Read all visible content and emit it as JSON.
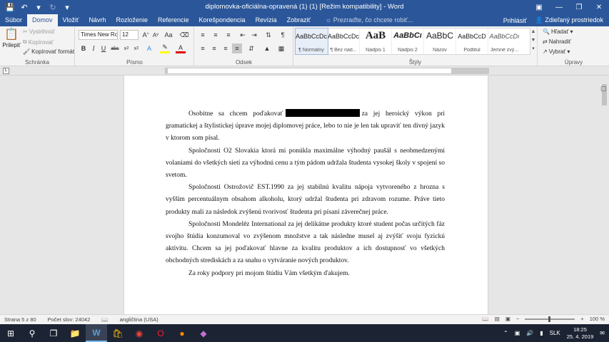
{
  "window": {
    "title": "diplomovka-oficiálna-opravená (1) (1) [Režim kompatibility] - Word"
  },
  "tabs": [
    "Súbor",
    "Domov",
    "Vložiť",
    "Návrh",
    "Rozloženie",
    "Referencie",
    "Korešpondencia",
    "Revízia",
    "Zobraziť"
  ],
  "active_tab": "Domov",
  "tell_me_placeholder": "Prezraďte, čo chcete robiť...",
  "account": {
    "sign_in": "Prihlásiť",
    "share": "Zdieľaný prostriedok"
  },
  "ribbon": {
    "clipboard": {
      "label": "Schránka",
      "paste": "Prilepiť",
      "cut": "Vystrihnúť",
      "copy": "Kopírovať",
      "format_painter": "Kopírovať formát"
    },
    "font": {
      "label": "Písmo",
      "font_name": "Times New Ro",
      "font_size": "12"
    },
    "paragraph": {
      "label": "Odsek"
    },
    "styles": {
      "label": "Štýly",
      "items": [
        {
          "preview": "AaBbCcDc",
          "name": "¶ Normálny"
        },
        {
          "preview": "AaBbCcDc",
          "name": "¶ Bez riad..."
        },
        {
          "preview": "AaB",
          "name": "Nadpis 1"
        },
        {
          "preview": "AaBbCı",
          "name": "Nadpis 2"
        },
        {
          "preview": "AaBbC",
          "name": "Názov"
        },
        {
          "preview": "AaBbCcD",
          "name": "Podtitul"
        },
        {
          "preview": "AaBbCcDı",
          "name": "Jemné zvý..."
        }
      ]
    },
    "editing": {
      "label": "Úpravy",
      "find": "Hľadať",
      "replace": "Nahradiť",
      "select": "Vybrať"
    }
  },
  "document": {
    "paragraphs": [
      {
        "before": "Osobitne sa chcem poďakovať",
        "after": "za jej heroický výkon pri gramatickej a štylistickej úprave mojej diplomovej práce, lebo to nie je len tak upraviť ten divný jazyk v ktorom som písal."
      },
      {
        "text": "Spoločnosti O2 Slovakia ktorá mi ponúkla maximálne výhodný paušál s neobmedzenými volaniami do všetkých sietí za výhodnú cenu a tým pádom udržala študenta vysokej školy v spojení so svetom."
      },
      {
        "text": "Spoločnosti Ostrožovič EST.1990 za jej stabilnú kvalitu nápoja vytvoreného z hrozna s vyšším percentuálnym obsahom alkoholu, ktorý udržal študenta pri zdravom rozume. Práve tieto produkty mali za následok zvýšenú tvorivosť študenta pri písaní záverečnej práce."
      },
      {
        "text": "Spoločnosti Mondelēz International za jej delikátne produkty ktoré student počas určitých fáz svojho štúdia konzumoval vo zvýšenom množstve a tak následne musel aj zvýšiť svoju fyzickú aktivitu. Chcem sa jej poďakovať hlavne za kvalitu produktov a ich dostupnosť vo všetkých obchodných strediskách a za snahu o vytváranie nových produktov."
      },
      {
        "text": "Za roky podpory pri mojom štúdiu Vám všetkým ďakujem."
      }
    ]
  },
  "status": {
    "page": "Strana 5 z 80",
    "word_count": "Počet slov: 24042",
    "language": "angličtina (USA)",
    "zoom": "100 %"
  },
  "taskbar": {
    "language": "SLK",
    "time": "18:25",
    "date": "25. 4. 2019"
  }
}
